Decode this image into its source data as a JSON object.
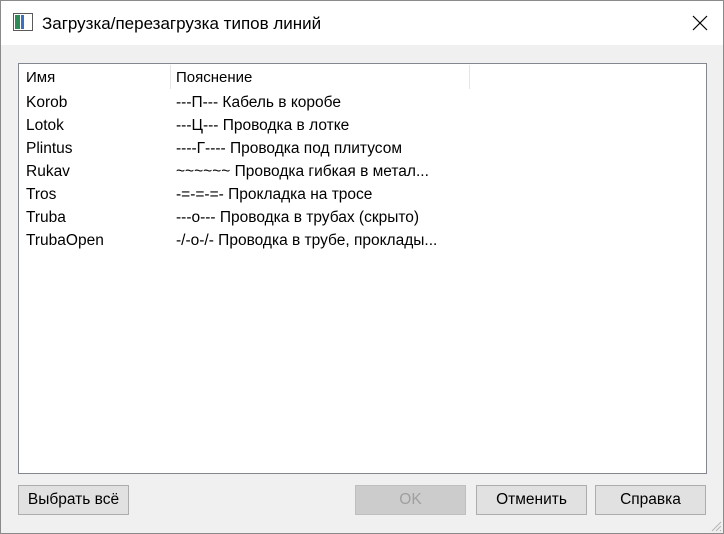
{
  "window": {
    "title": "Загрузка/перезагрузка типов линий"
  },
  "list": {
    "columns": [
      "Имя",
      "Пояснение"
    ],
    "rows": [
      {
        "name": "Korob",
        "desc": "---П--- Кабель в коробе"
      },
      {
        "name": "Lotok",
        "desc": "---Ц--- Проводка в лотке"
      },
      {
        "name": "Plintus",
        "desc": "----Г---- Проводка под плитусом"
      },
      {
        "name": "Rukav",
        "desc": "~~~~~~ Проводка гибкая в метал..."
      },
      {
        "name": "Tros",
        "desc": "-=-=-=- Прокладка на тросе"
      },
      {
        "name": "Truba",
        "desc": "---о--- Проводка в трубах (скрыто)"
      },
      {
        "name": "TrubaOpen",
        "desc": "-/-о-/- Проводка в трубе, проклады..."
      }
    ]
  },
  "buttons": {
    "select_all": "Выбрать всё",
    "ok": "OK",
    "cancel": "Отменить",
    "help": "Справка"
  },
  "icons": {
    "app": "app-window-icon",
    "close": "close-icon",
    "grip": "resize-grip-icon"
  }
}
